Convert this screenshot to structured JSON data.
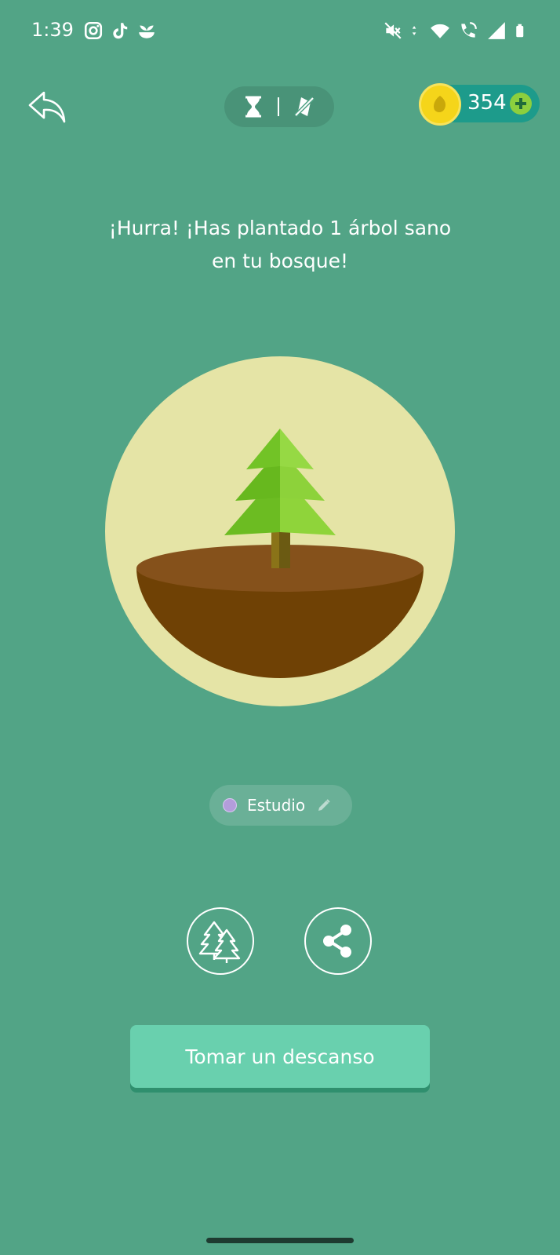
{
  "status_bar": {
    "time": "1:39",
    "left_icons": [
      "instagram-icon",
      "tiktok-icon",
      "forest-sprout-icon"
    ],
    "right_icons": [
      "mute-icon",
      "data-arrows-icon",
      "wifi-icon",
      "wifi-calling-icon",
      "signal-icon",
      "battery-icon"
    ]
  },
  "top_bar": {
    "back_icon": "back-arrow-icon",
    "mode_icons": [
      "hourglass-icon",
      "no-phone-icon"
    ],
    "coins": "354"
  },
  "headline": {
    "line1": "¡Hurra! ¡Has plantado 1 árbol sano",
    "line2": "en tu bosque!"
  },
  "tag": {
    "label": "Estudio",
    "dot_color": "#b39ddb"
  },
  "actions": {
    "forest_icon": "forest-icon",
    "share_icon": "share-icon",
    "break_label": "Tomar un descanso"
  },
  "colors": {
    "background": "#52a486",
    "coin": "#f5d51a",
    "break_button": "#69d0ae"
  }
}
